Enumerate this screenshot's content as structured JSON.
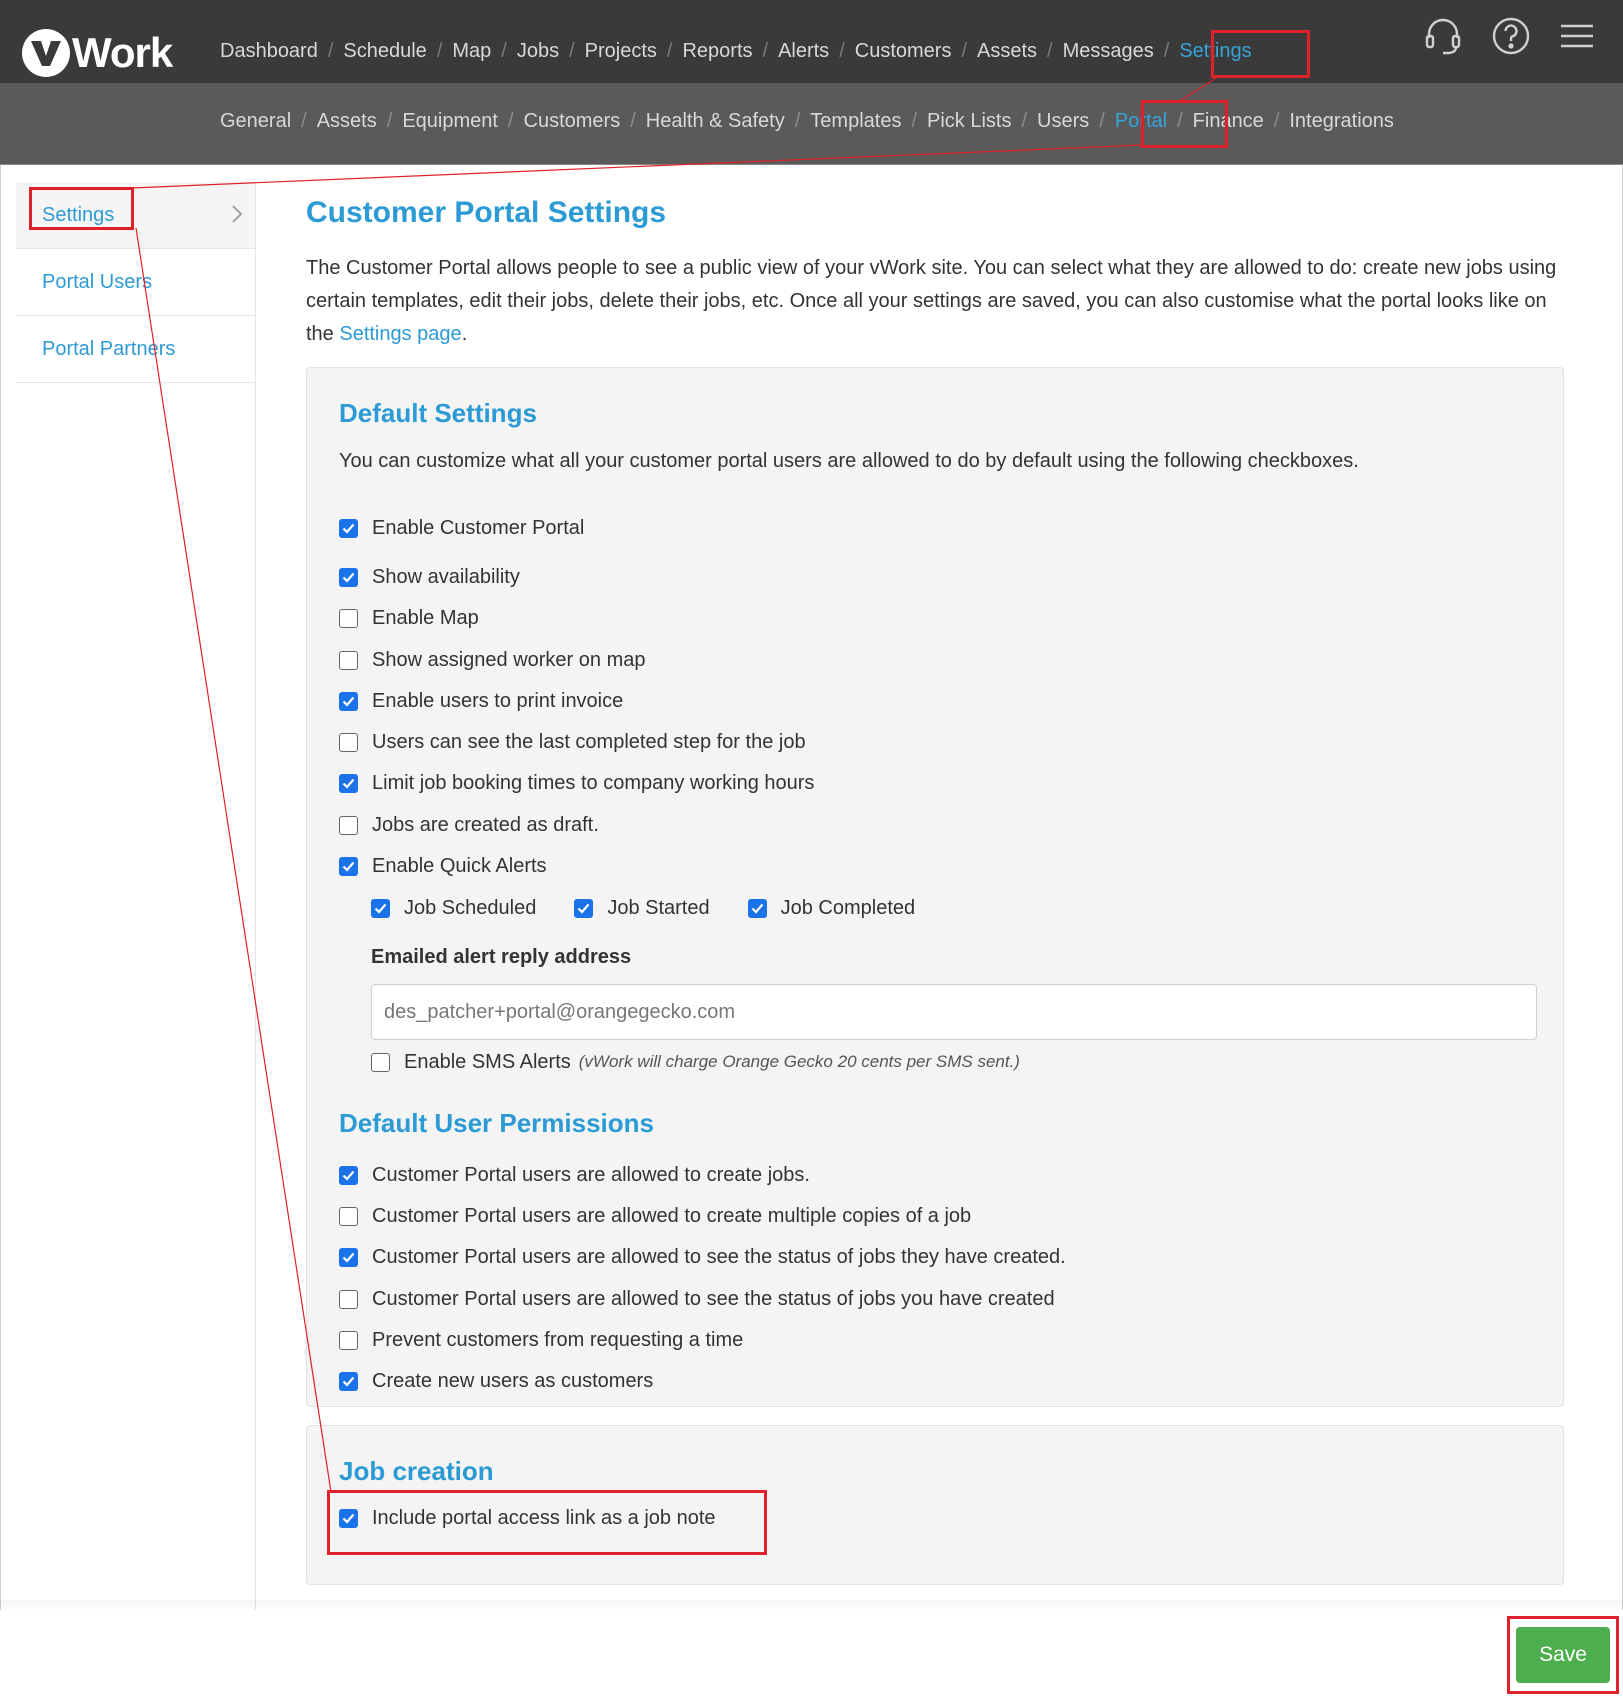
{
  "app": {
    "logo_text": "Work"
  },
  "topnav": {
    "items": [
      "Dashboard",
      "Schedule",
      "Map",
      "Jobs",
      "Projects",
      "Reports",
      "Alerts",
      "Customers",
      "Assets",
      "Messages",
      "Settings"
    ],
    "separator": "/",
    "active": "Settings",
    "icons": [
      "headset-icon",
      "help-icon",
      "menu-icon"
    ]
  },
  "subnav": {
    "items": [
      "General",
      "Assets",
      "Equipment",
      "Customers",
      "Health & Safety",
      "Templates",
      "Pick Lists",
      "Users",
      "Portal",
      "Finance",
      "Integrations"
    ],
    "separator": "/",
    "active": "Portal"
  },
  "sidebar": {
    "items": [
      {
        "label": "Settings",
        "active": true
      },
      {
        "label": "Portal Users",
        "active": false
      },
      {
        "label": "Portal Partners",
        "active": false
      }
    ]
  },
  "main": {
    "title": "Customer Portal Settings",
    "intro_before_link": "The Customer Portal allows people to see a public view of your vWork site. You can select what they are allowed to do: create new jobs using certain templates, edit their jobs, delete their jobs, etc. Once all your settings are saved, you can also customise what the portal looks like on the ",
    "intro_link": "Settings page",
    "intro_after_link": "."
  },
  "default_settings": {
    "title": "Default Settings",
    "description": "You can customize what all your customer portal users are allowed to do by default using the following checkboxes.",
    "options": [
      {
        "label": "Enable Customer Portal",
        "checked": true
      },
      {
        "label": "Show availability",
        "checked": true
      },
      {
        "label": "Enable Map",
        "checked": false
      },
      {
        "label": "Show assigned worker on map",
        "checked": false
      },
      {
        "label": "Enable users to print invoice",
        "checked": true
      },
      {
        "label": "Users can see the last completed step for the job",
        "checked": false
      },
      {
        "label": "Limit job booking times to company working hours",
        "checked": true
      },
      {
        "label": "Jobs are created as draft.",
        "checked": false
      },
      {
        "label": "Enable Quick Alerts",
        "checked": true
      }
    ],
    "quick_alerts": [
      {
        "label": "Job Scheduled",
        "checked": true
      },
      {
        "label": "Job Started",
        "checked": true
      },
      {
        "label": "Job Completed",
        "checked": true
      }
    ],
    "reply_address_label": "Emailed alert reply address",
    "reply_address_placeholder": "des_patcher+portal@orangegecko.com",
    "sms": {
      "label": "Enable SMS Alerts",
      "note": "(vWork will charge Orange Gecko  20 cents per SMS sent.)",
      "checked": false
    }
  },
  "user_permissions": {
    "title": "Default User Permissions",
    "options": [
      {
        "label": "Customer Portal users are allowed to create jobs.",
        "checked": true
      },
      {
        "label": "Customer Portal users are allowed to create multiple copies of a job",
        "checked": false
      },
      {
        "label": "Customer Portal users are allowed to see the status of jobs they have created.",
        "checked": true
      },
      {
        "label": "Customer Portal users are allowed to see the status of jobs you have created",
        "checked": false
      },
      {
        "label": "Prevent customers from requesting a time",
        "checked": false
      },
      {
        "label": "Create new users as customers",
        "checked": true
      }
    ]
  },
  "job_creation": {
    "title": "Job creation",
    "options": [
      {
        "label": "Include portal access link as a job note",
        "checked": true
      }
    ]
  },
  "footer": {
    "save_label": "Save"
  },
  "colors": {
    "accent": "#2b9ad5",
    "topbar": "#3a3a3a",
    "subbar": "#5a5a5a",
    "save": "#4cae4c",
    "annotation": "#e0202a"
  }
}
